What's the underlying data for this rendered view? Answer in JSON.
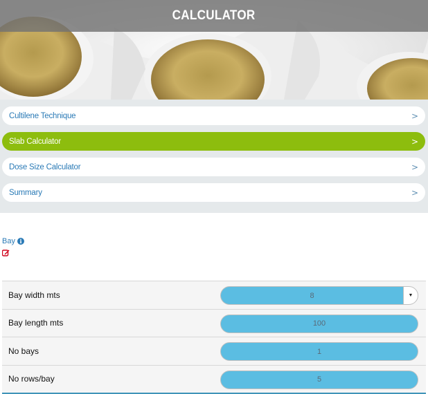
{
  "header": {
    "title": "CALCULATOR"
  },
  "menu": {
    "items": [
      {
        "label": "Cultilene Technique",
        "chevron": ">",
        "active": false
      },
      {
        "label": "Slab Calculator",
        "chevron": ">",
        "active": true
      },
      {
        "label": "Dose Size Calculator",
        "chevron": ">",
        "active": false
      },
      {
        "label": "Summary",
        "chevron": ">",
        "active": false
      }
    ]
  },
  "bay": {
    "heading": "Bay",
    "info_icon": "i",
    "rows": [
      {
        "label": "Bay width mts",
        "value": "8",
        "has_dropdown": true
      },
      {
        "label": "Bay length mts",
        "value": "100"
      },
      {
        "label": "No bays",
        "value": "1"
      },
      {
        "label": "No rows/bay",
        "value": "5"
      }
    ]
  },
  "colors": {
    "accent_green": "#8dbd0e",
    "link_blue": "#2a7ab6",
    "field_blue": "#5bbde2",
    "menu_bg": "#e5e9eb",
    "edit_red": "#d0021b"
  }
}
